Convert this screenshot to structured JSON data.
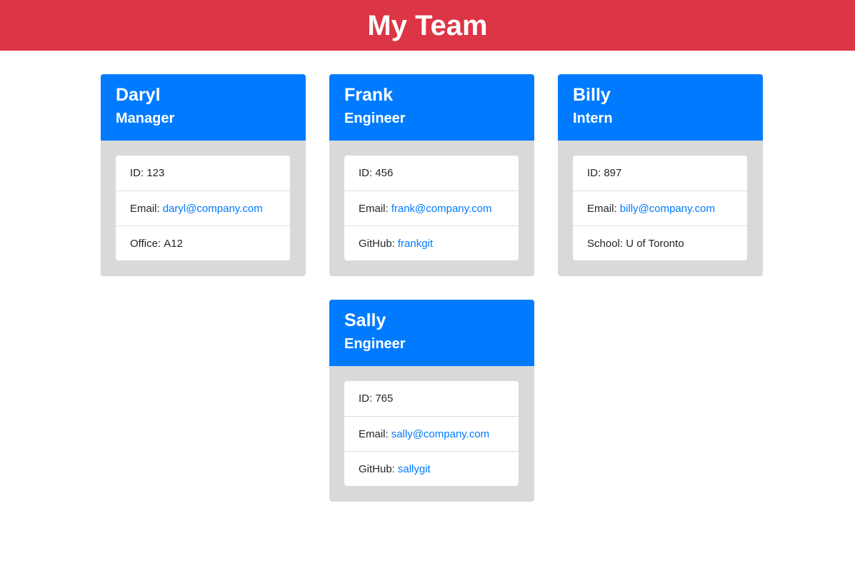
{
  "header": {
    "title": "My Team"
  },
  "colors": {
    "header_bg": "#dc3545",
    "card_header_bg": "#007bff",
    "card_body_bg": "#d9d9d9",
    "link": "#007bff"
  },
  "team": [
    {
      "name": "Daryl",
      "role": "Manager",
      "id_label": "ID:",
      "id": "123",
      "email_label": "Email:",
      "email": "daryl@company.com",
      "extra_label": "Office:",
      "extra": "A12"
    },
    {
      "name": "Frank",
      "role": "Engineer",
      "id_label": "ID:",
      "id": "456",
      "email_label": "Email:",
      "email": "frank@company.com",
      "extra_label": "GitHub:",
      "extra": "frankgit"
    },
    {
      "name": "Billy",
      "role": "Intern",
      "id_label": "ID:",
      "id": "897",
      "email_label": "Email:",
      "email": "billy@company.com",
      "extra_label": "School:",
      "extra": "U of Toronto"
    },
    {
      "name": "Sally",
      "role": "Engineer",
      "id_label": "ID:",
      "id": "765",
      "email_label": "Email:",
      "email": "sally@company.com",
      "extra_label": "GitHub:",
      "extra": "sallygit"
    }
  ]
}
